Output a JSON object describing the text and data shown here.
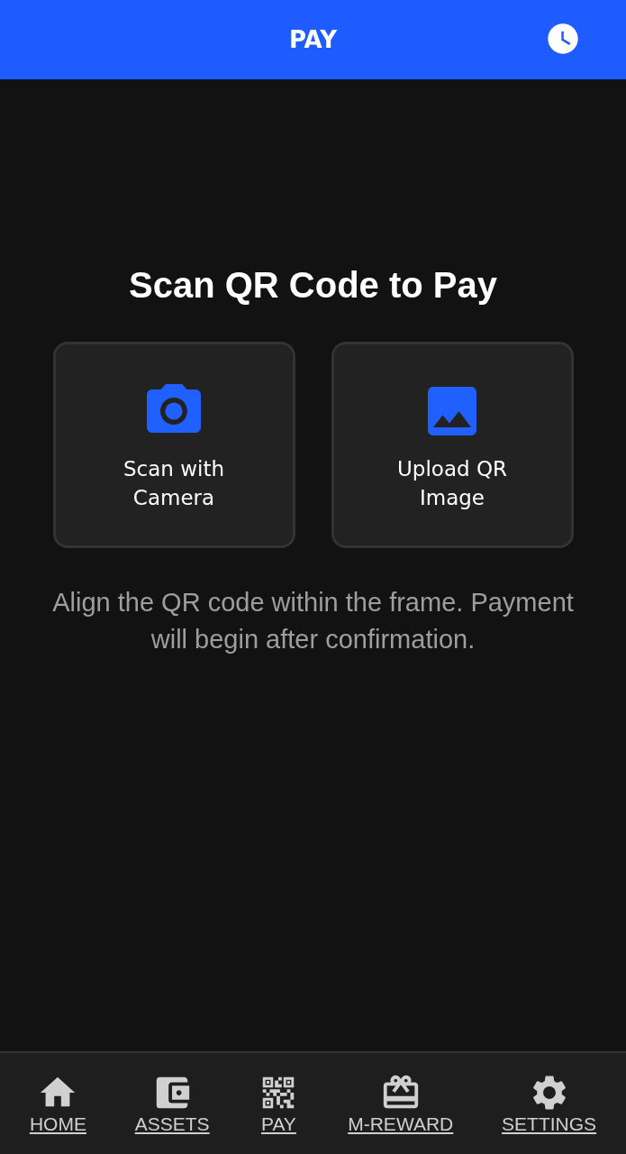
{
  "header": {
    "title": "PAY"
  },
  "heading": "Scan QR Code to Pay",
  "options": [
    {
      "kind": "camera",
      "label": "Scan with Camera"
    },
    {
      "kind": "image",
      "label": "Upload QR Image"
    }
  ],
  "hint": "Align the QR code within the frame. Payment will begin after confirmation.",
  "nav": [
    {
      "kind": "home",
      "label": "HOME"
    },
    {
      "kind": "wallet",
      "label": "ASSETS"
    },
    {
      "kind": "qr",
      "label": "PAY"
    },
    {
      "kind": "gift",
      "label": "M-REWARD"
    },
    {
      "kind": "settings",
      "label": "SETTINGS"
    }
  ]
}
